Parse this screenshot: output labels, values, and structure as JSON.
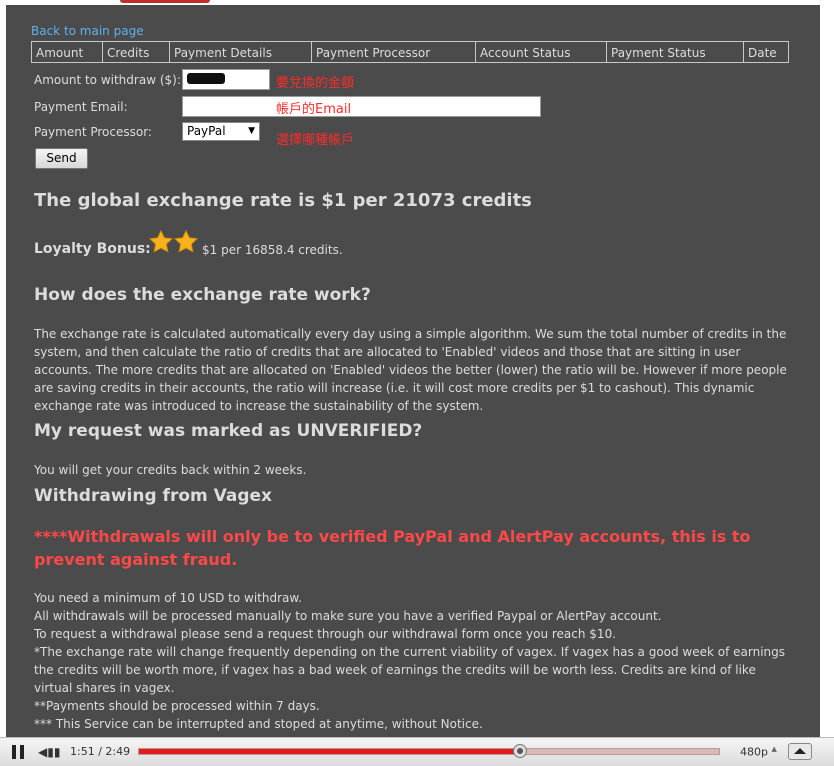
{
  "nav": {
    "back_link": "Back to main page"
  },
  "table": {
    "headers": [
      "Amount",
      "Credits",
      "Payment Details",
      "Payment Processor",
      "Account Status",
      "Payment Status",
      "Date"
    ]
  },
  "form": {
    "amount_label": "Amount to withdraw ($):",
    "amount_note": "要兌換的金額",
    "email_label": "Payment Email:",
    "email_note": "帳戶的Email",
    "processor_label": "Payment Processor:",
    "processor_value": "PayPal",
    "processor_note": "選擇哪種帳戶",
    "send_label": "Send"
  },
  "rate": {
    "headline": "The global exchange rate is $1 per 21073 credits"
  },
  "loyalty": {
    "label": "Loyalty Bonus:",
    "stars": 2,
    "text": "$1 per 16858.4 credits."
  },
  "sections": {
    "how_title": "How does the exchange rate work?",
    "how_body": "The exchange rate is calculated automatically every day using a simple algorithm. We sum the total number of credits in the system, and then calculate the ratio of credits that are allocated to 'Enabled' videos and those that are sitting in user accounts. The more credits that are allocated on 'Enabled' videos the better (lower) the ratio will be. However if more people are saving credits in their accounts, the ratio will increase (i.e. it will cost more credits per $1 to cashout). This dynamic exchange rate was introduced to increase the sustainability of the system.",
    "unverified_title": "My request was marked as UNVERIFIED?",
    "unverified_body": "You will get your credits back within 2 weeks.",
    "withdraw_title": "Withdrawing from Vagex",
    "warning": "****Withdrawals will only be to verified PayPal and AlertPay accounts, this is to prevent against fraud.",
    "rules": [
      "You need a minimum of 10 USD to withdraw.",
      "All withdrawals will be processed manually to make sure you have a verified Paypal or AlertPay account.",
      "To request a withdrawal please send a request through our withdrawal form once you reach $10.",
      "*The exchange rate will change frequently depending on the current viability of vagex. If vagex has a good week of earnings the credits will be worth more, if vagex has a bad week of earnings the credits will be worth less. Credits are kind of like virtual shares in vagex.",
      "**Payments should be processed within 7 days.",
      "*** This Service can be interrupted and stoped at anytime, without Notice."
    ]
  },
  "player": {
    "time": "1:51 / 2:49",
    "progress": 0.657,
    "quality": "480p",
    "colors": {
      "progress": "#e01c1c"
    }
  },
  "colors": {
    "panel": "#4b4b4b",
    "link": "#5fb0f0",
    "warning": "#ff4848",
    "note": "#ff2a2a"
  }
}
